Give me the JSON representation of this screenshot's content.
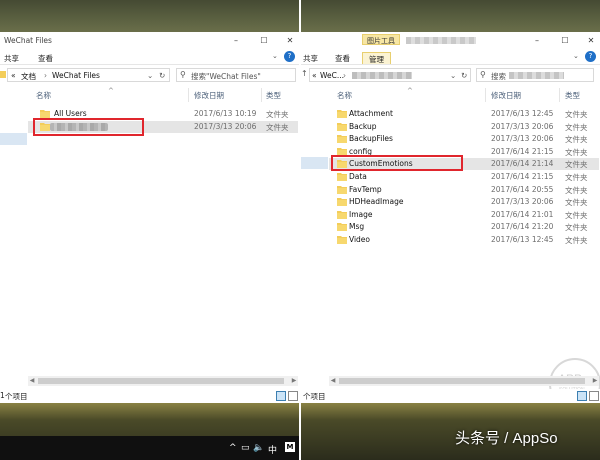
{
  "left": {
    "title": "WeChat Files",
    "ribbon_tabs": [
      "共享",
      "查看"
    ],
    "breadcrumb_chevron": "«",
    "breadcrumb_parts": [
      "文档",
      "WeChat Files"
    ],
    "search_placeholder": "搜索\"WeChat Files\"",
    "columns": {
      "name": "名称",
      "date": "修改日期",
      "type": "类型"
    },
    "rows": [
      {
        "name": "All Users",
        "date": "2017/6/13 10:19",
        "type": "文件夹",
        "blurred": false
      },
      {
        "name": "",
        "date": "2017/3/13 20:06",
        "type": "文件夹",
        "blurred": true
      }
    ],
    "status": "个项目",
    "status_prefix": "1"
  },
  "right": {
    "title": "",
    "tools_tab": "图片工具",
    "ribbon_tabs": [
      "共享",
      "查看",
      "管理"
    ],
    "breadcrumb_chevron": "«",
    "breadcrumb_parts": [
      "WeC..."
    ],
    "search_prefix": "搜索",
    "columns": {
      "name": "名称",
      "date": "修改日期",
      "type": "类型"
    },
    "rows": [
      {
        "name": "Attachment",
        "date": "2017/6/13 12:45",
        "type": "文件夹"
      },
      {
        "name": "Backup",
        "date": "2017/3/13 20:06",
        "type": "文件夹"
      },
      {
        "name": "BackupFiles",
        "date": "2017/3/13 20:06",
        "type": "文件夹"
      },
      {
        "name": "config",
        "date": "2017/6/14 21:15",
        "type": "文件夹"
      },
      {
        "name": "CustomEmotions",
        "date": "2017/6/14 21:14",
        "type": "文件夹"
      },
      {
        "name": "Data",
        "date": "2017/6/14 21:15",
        "type": "文件夹"
      },
      {
        "name": "FavTemp",
        "date": "2017/6/14 20:55",
        "type": "文件夹"
      },
      {
        "name": "HDHeadImage",
        "date": "2017/3/13 20:06",
        "type": "文件夹"
      },
      {
        "name": "Image",
        "date": "2017/6/14 21:01",
        "type": "文件夹"
      },
      {
        "name": "Msg",
        "date": "2017/6/14 21:20",
        "type": "文件夹"
      },
      {
        "name": "Video",
        "date": "2017/6/13 12:45",
        "type": "文件夹"
      }
    ],
    "highlighted_row": "CustomEmotions",
    "status": "个项目"
  },
  "taskbar": {
    "ime": "中",
    "badge": "M"
  },
  "watermark": {
    "app": "APP",
    "solution": "SOLUTION"
  },
  "brand": "头条号 / AppSo",
  "colors": {
    "highlight_box": "#e0262d",
    "folder": "#f3cd5a",
    "selection": "#cce4f7",
    "accent": "#1f6fc7"
  }
}
